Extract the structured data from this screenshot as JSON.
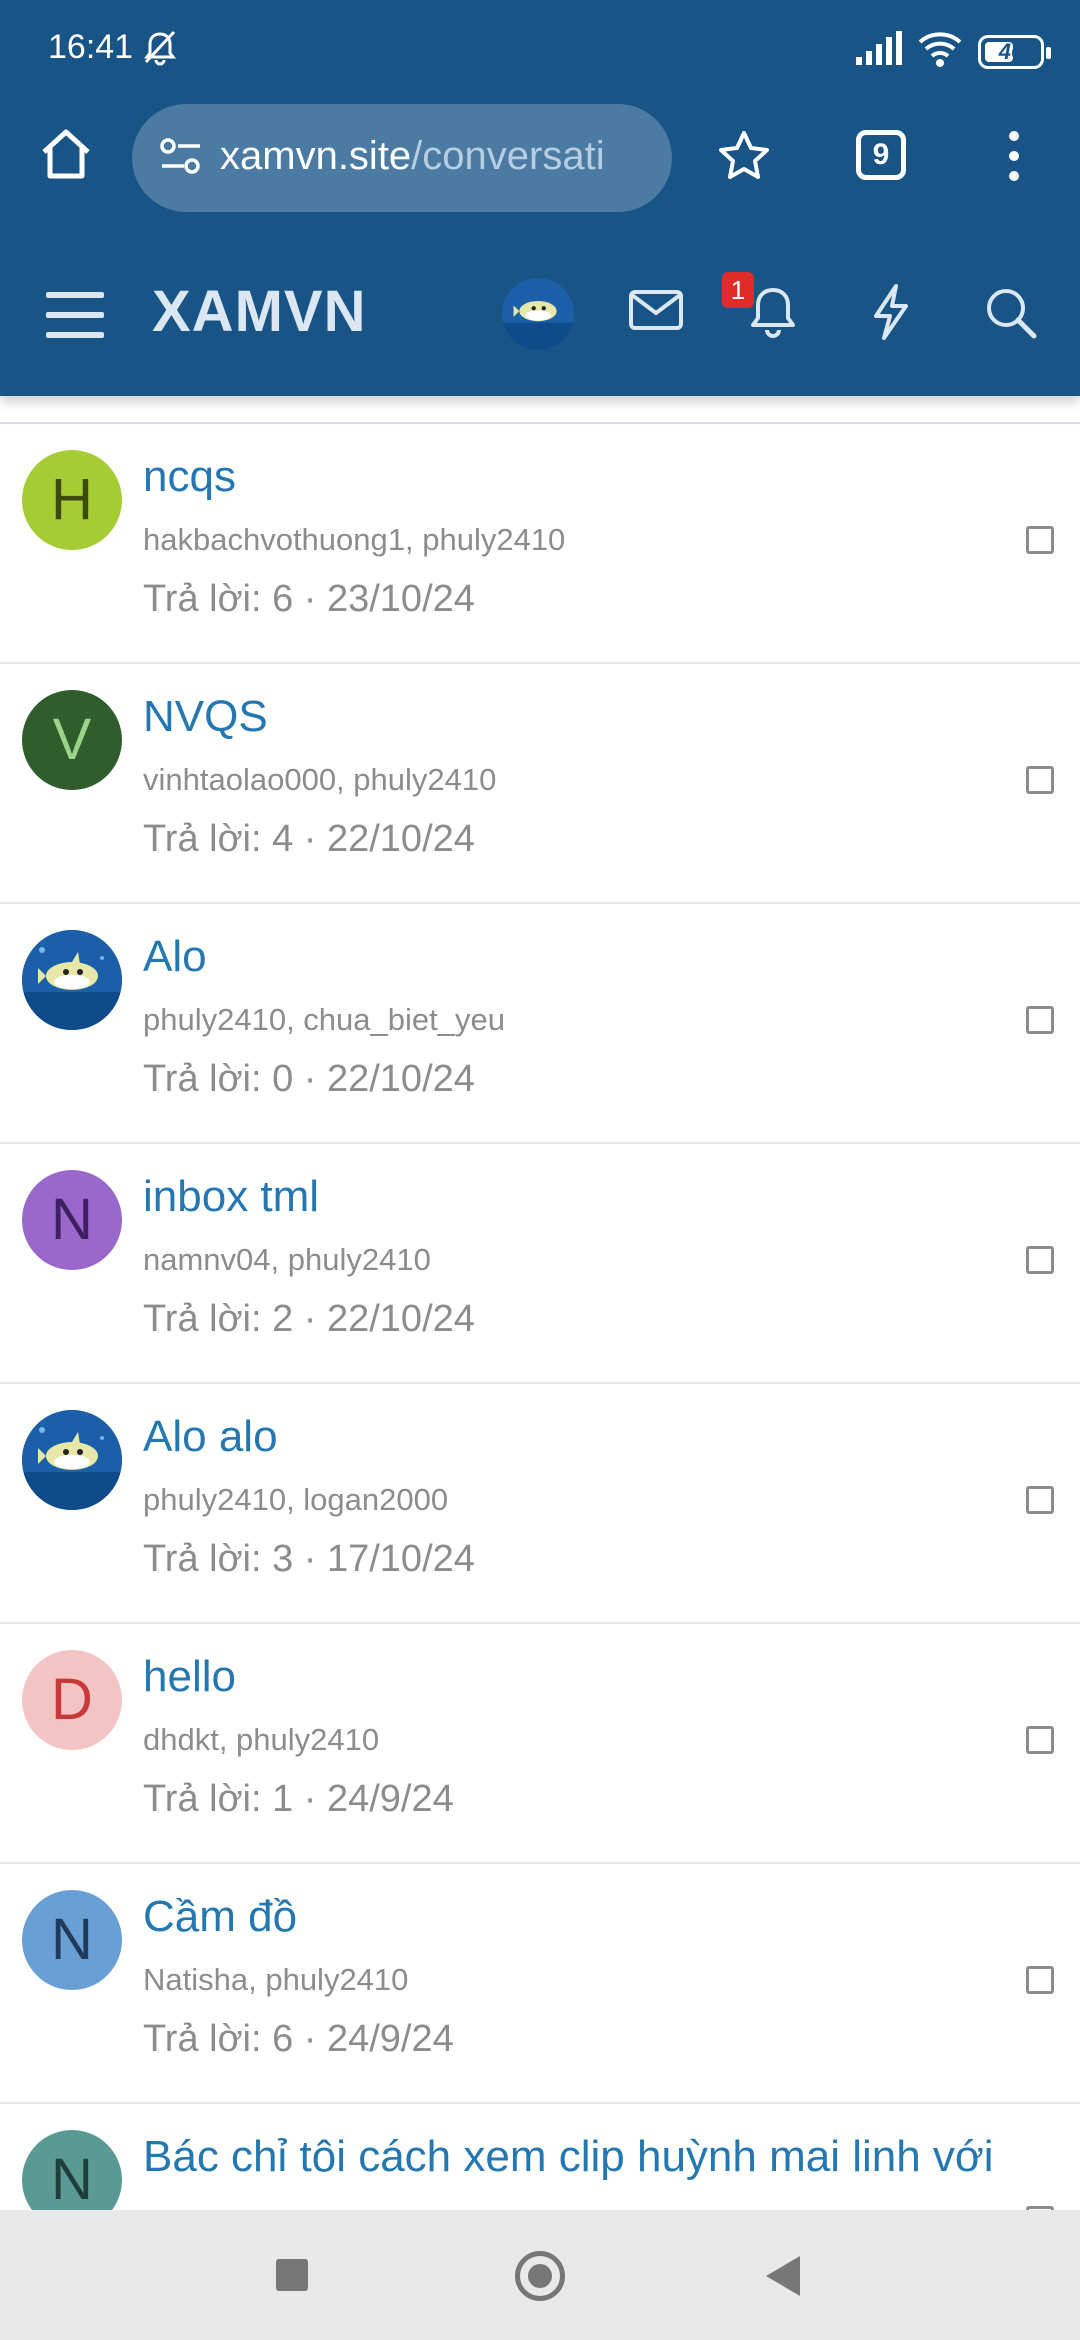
{
  "status_bar": {
    "time": "16:41",
    "battery": "46"
  },
  "browser": {
    "url_domain": "xamvn.site",
    "url_path": "/conversati",
    "tab_count": "9"
  },
  "site_header": {
    "logo": "XAMVN",
    "notification_count": "1"
  },
  "colors": {
    "header_bg": "#185486",
    "link": "#2577b1",
    "muted": "#8c8c8c",
    "badge": "#e02b2b"
  },
  "conversations": [
    {
      "title": "ncqs",
      "participants": "hakbachvothuong1, phuly2410",
      "meta": "Trả lời: 6 · 23/10/24",
      "avatar_letter": "H",
      "avatar_bg": "#a6cc34",
      "avatar_fg": "#3c4a10",
      "avatar_image": ""
    },
    {
      "title": "NVQS",
      "participants": "vinhtaolao000, phuly2410",
      "meta": "Trả lời: 4 · 22/10/24",
      "avatar_letter": "V",
      "avatar_bg": "#2f5d2c",
      "avatar_fg": "#9ad38a",
      "avatar_image": ""
    },
    {
      "title": "Alo",
      "participants": "phuly2410, chua_biet_yeu",
      "meta": "Trả lời: 0 · 22/10/24",
      "avatar_letter": "",
      "avatar_bg": "#1b5fa8",
      "avatar_fg": "#ffffff",
      "avatar_image": "shark"
    },
    {
      "title": "inbox tml",
      "participants": "namnv04, phuly2410",
      "meta": "Trả lời: 2 · 22/10/24",
      "avatar_letter": "N",
      "avatar_bg": "#9a67cc",
      "avatar_fg": "#3d2060",
      "avatar_image": ""
    },
    {
      "title": "Alo alo",
      "participants": "phuly2410, logan2000",
      "meta": "Trả lời: 3 · 17/10/24",
      "avatar_letter": "",
      "avatar_bg": "#1b5fa8",
      "avatar_fg": "#ffffff",
      "avatar_image": "shark"
    },
    {
      "title": "hello",
      "participants": "dhdkt, phuly2410",
      "meta": "Trả lời: 1 · 24/9/24",
      "avatar_letter": "D",
      "avatar_bg": "#f2c4c4",
      "avatar_fg": "#c83a3a",
      "avatar_image": ""
    },
    {
      "title": "Cầm đồ",
      "participants": "Natisha, phuly2410",
      "meta": "Trả lời: 6 · 24/9/24",
      "avatar_letter": "N",
      "avatar_bg": "#6a9fd6",
      "avatar_fg": "#1f3a5a",
      "avatar_image": ""
    },
    {
      "title": "Bác chỉ tôi cách xem clip huỳnh mai linh với",
      "participants": "",
      "meta": "",
      "avatar_letter": "N",
      "avatar_bg": "#5b9a94",
      "avatar_fg": "#1f3e3b",
      "avatar_image": ""
    }
  ]
}
